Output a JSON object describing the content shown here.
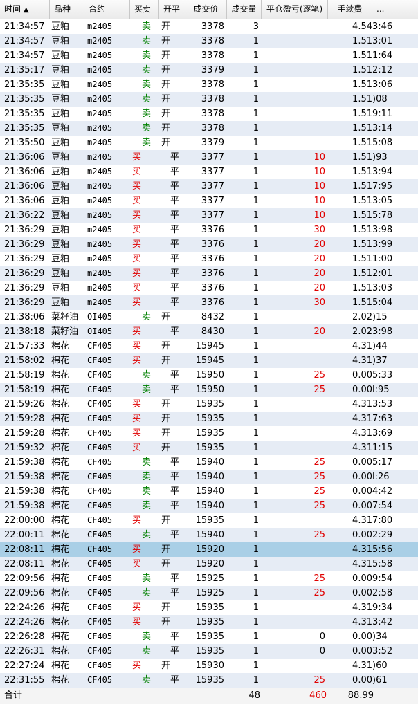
{
  "header": {
    "time": "时间",
    "sort_indicator": "▲",
    "product": "品种",
    "contract": "合约",
    "side": "买卖",
    "open_close": "开平",
    "price": "成交价",
    "volume": "成交量",
    "pnl": "平仓盈亏(逐笔)",
    "fee": "手续费",
    "more": "..."
  },
  "rows": [
    {
      "time": "21:34:57",
      "product": "豆粕",
      "contract": "m2405",
      "side": "卖",
      "oc": "开",
      "price": "3378",
      "vol": "3",
      "pnl": "",
      "fee": "4.54",
      "extra": "3:46"
    },
    {
      "time": "21:34:57",
      "product": "豆粕",
      "contract": "m2405",
      "side": "卖",
      "oc": "开",
      "price": "3378",
      "vol": "1",
      "pnl": "",
      "fee": "1.51",
      "extra": "3:01"
    },
    {
      "time": "21:34:57",
      "product": "豆粕",
      "contract": "m2405",
      "side": "卖",
      "oc": "开",
      "price": "3378",
      "vol": "1",
      "pnl": "",
      "fee": "1.51",
      "extra": "1:64"
    },
    {
      "time": "21:35:17",
      "product": "豆粕",
      "contract": "m2405",
      "side": "卖",
      "oc": "开",
      "price": "3379",
      "vol": "1",
      "pnl": "",
      "fee": "1.51",
      "extra": "2:12"
    },
    {
      "time": "21:35:35",
      "product": "豆粕",
      "contract": "m2405",
      "side": "卖",
      "oc": "开",
      "price": "3378",
      "vol": "1",
      "pnl": "",
      "fee": "1.51",
      "extra": "3:06"
    },
    {
      "time": "21:35:35",
      "product": "豆粕",
      "contract": "m2405",
      "side": "卖",
      "oc": "开",
      "price": "3378",
      "vol": "1",
      "pnl": "",
      "fee": "1.51",
      "extra": ")08"
    },
    {
      "time": "21:35:35",
      "product": "豆粕",
      "contract": "m2405",
      "side": "卖",
      "oc": "开",
      "price": "3378",
      "vol": "1",
      "pnl": "",
      "fee": "1.51",
      "extra": "9:11"
    },
    {
      "time": "21:35:35",
      "product": "豆粕",
      "contract": "m2405",
      "side": "卖",
      "oc": "开",
      "price": "3378",
      "vol": "1",
      "pnl": "",
      "fee": "1.51",
      "extra": "3:14"
    },
    {
      "time": "21:35:50",
      "product": "豆粕",
      "contract": "m2405",
      "side": "卖",
      "oc": "开",
      "price": "3379",
      "vol": "1",
      "pnl": "",
      "fee": "1.51",
      "extra": "5:08"
    },
    {
      "time": "21:36:06",
      "product": "豆粕",
      "contract": "m2405",
      "side": "买",
      "oc": "平",
      "price": "3377",
      "vol": "1",
      "pnl": "10",
      "fee": "1.51",
      "extra": ")93"
    },
    {
      "time": "21:36:06",
      "product": "豆粕",
      "contract": "m2405",
      "side": "买",
      "oc": "平",
      "price": "3377",
      "vol": "1",
      "pnl": "10",
      "fee": "1.51",
      "extra": "3:94"
    },
    {
      "time": "21:36:06",
      "product": "豆粕",
      "contract": "m2405",
      "side": "买",
      "oc": "平",
      "price": "3377",
      "vol": "1",
      "pnl": "10",
      "fee": "1.51",
      "extra": "7:95"
    },
    {
      "time": "21:36:06",
      "product": "豆粕",
      "contract": "m2405",
      "side": "买",
      "oc": "平",
      "price": "3377",
      "vol": "1",
      "pnl": "10",
      "fee": "1.51",
      "extra": "3:05"
    },
    {
      "time": "21:36:22",
      "product": "豆粕",
      "contract": "m2405",
      "side": "买",
      "oc": "平",
      "price": "3377",
      "vol": "1",
      "pnl": "10",
      "fee": "1.51",
      "extra": "5:78"
    },
    {
      "time": "21:36:29",
      "product": "豆粕",
      "contract": "m2405",
      "side": "买",
      "oc": "平",
      "price": "3376",
      "vol": "1",
      "pnl": "30",
      "fee": "1.51",
      "extra": "3:98"
    },
    {
      "time": "21:36:29",
      "product": "豆粕",
      "contract": "m2405",
      "side": "买",
      "oc": "平",
      "price": "3376",
      "vol": "1",
      "pnl": "20",
      "fee": "1.51",
      "extra": "3:99"
    },
    {
      "time": "21:36:29",
      "product": "豆粕",
      "contract": "m2405",
      "side": "买",
      "oc": "平",
      "price": "3376",
      "vol": "1",
      "pnl": "20",
      "fee": "1.51",
      "extra": "1:00"
    },
    {
      "time": "21:36:29",
      "product": "豆粕",
      "contract": "m2405",
      "side": "买",
      "oc": "平",
      "price": "3376",
      "vol": "1",
      "pnl": "20",
      "fee": "1.51",
      "extra": "2:01"
    },
    {
      "time": "21:36:29",
      "product": "豆粕",
      "contract": "m2405",
      "side": "买",
      "oc": "平",
      "price": "3376",
      "vol": "1",
      "pnl": "20",
      "fee": "1.51",
      "extra": "3:03"
    },
    {
      "time": "21:36:29",
      "product": "豆粕",
      "contract": "m2405",
      "side": "买",
      "oc": "平",
      "price": "3376",
      "vol": "1",
      "pnl": "30",
      "fee": "1.51",
      "extra": "5:04"
    },
    {
      "time": "21:38:06",
      "product": "菜籽油",
      "contract": "OI405",
      "side": "卖",
      "oc": "开",
      "price": "8432",
      "vol": "1",
      "pnl": "",
      "fee": "2.02",
      "extra": ")15"
    },
    {
      "time": "21:38:18",
      "product": "菜籽油",
      "contract": "OI405",
      "side": "买",
      "oc": "平",
      "price": "8430",
      "vol": "1",
      "pnl": "20",
      "fee": "2.02",
      "extra": "3:98"
    },
    {
      "time": "21:57:33",
      "product": "棉花",
      "contract": "CF405",
      "side": "买",
      "oc": "开",
      "price": "15945",
      "vol": "1",
      "pnl": "",
      "fee": "4.31",
      "extra": ")44"
    },
    {
      "time": "21:58:02",
      "product": "棉花",
      "contract": "CF405",
      "side": "买",
      "oc": "开",
      "price": "15945",
      "vol": "1",
      "pnl": "",
      "fee": "4.31",
      "extra": ")37"
    },
    {
      "time": "21:58:19",
      "product": "棉花",
      "contract": "CF405",
      "side": "卖",
      "oc": "平",
      "price": "15950",
      "vol": "1",
      "pnl": "25",
      "fee": "0.00",
      "extra": "5:33"
    },
    {
      "time": "21:58:19",
      "product": "棉花",
      "contract": "CF405",
      "side": "卖",
      "oc": "平",
      "price": "15950",
      "vol": "1",
      "pnl": "25",
      "fee": "0.00",
      "extra": "l:95"
    },
    {
      "time": "21:59:26",
      "product": "棉花",
      "contract": "CF405",
      "side": "买",
      "oc": "开",
      "price": "15935",
      "vol": "1",
      "pnl": "",
      "fee": "4.31",
      "extra": "3:53"
    },
    {
      "time": "21:59:28",
      "product": "棉花",
      "contract": "CF405",
      "side": "买",
      "oc": "开",
      "price": "15935",
      "vol": "1",
      "pnl": "",
      "fee": "4.31",
      "extra": "7:63"
    },
    {
      "time": "21:59:28",
      "product": "棉花",
      "contract": "CF405",
      "side": "买",
      "oc": "开",
      "price": "15935",
      "vol": "1",
      "pnl": "",
      "fee": "4.31",
      "extra": "3:69"
    },
    {
      "time": "21:59:32",
      "product": "棉花",
      "contract": "CF405",
      "side": "买",
      "oc": "开",
      "price": "15935",
      "vol": "1",
      "pnl": "",
      "fee": "4.31",
      "extra": "1:15"
    },
    {
      "time": "21:59:38",
      "product": "棉花",
      "contract": "CF405",
      "side": "卖",
      "oc": "平",
      "price": "15940",
      "vol": "1",
      "pnl": "25",
      "fee": "0.00",
      "extra": "5:17"
    },
    {
      "time": "21:59:38",
      "product": "棉花",
      "contract": "CF405",
      "side": "卖",
      "oc": "平",
      "price": "15940",
      "vol": "1",
      "pnl": "25",
      "fee": "0.00",
      "extra": "l:26"
    },
    {
      "time": "21:59:38",
      "product": "棉花",
      "contract": "CF405",
      "side": "卖",
      "oc": "平",
      "price": "15940",
      "vol": "1",
      "pnl": "25",
      "fee": "0.00",
      "extra": "4:42"
    },
    {
      "time": "21:59:38",
      "product": "棉花",
      "contract": "CF405",
      "side": "卖",
      "oc": "平",
      "price": "15940",
      "vol": "1",
      "pnl": "25",
      "fee": "0.00",
      "extra": "7:54"
    },
    {
      "time": "22:00:00",
      "product": "棉花",
      "contract": "CF405",
      "side": "买",
      "oc": "开",
      "price": "15935",
      "vol": "1",
      "pnl": "",
      "fee": "4.31",
      "extra": "7:80"
    },
    {
      "time": "22:00:11",
      "product": "棉花",
      "contract": "CF405",
      "side": "卖",
      "oc": "平",
      "price": "15940",
      "vol": "1",
      "pnl": "25",
      "fee": "0.00",
      "extra": "2:29"
    },
    {
      "time": "22:08:11",
      "product": "棉花",
      "contract": "CF405",
      "side": "买",
      "oc": "开",
      "price": "15920",
      "vol": "1",
      "pnl": "",
      "fee": "4.31",
      "extra": "5:56"
    },
    {
      "time": "22:08:11",
      "product": "棉花",
      "contract": "CF405",
      "side": "买",
      "oc": "开",
      "price": "15920",
      "vol": "1",
      "pnl": "",
      "fee": "4.31",
      "extra": "5:58"
    },
    {
      "time": "22:09:56",
      "product": "棉花",
      "contract": "CF405",
      "side": "卖",
      "oc": "平",
      "price": "15925",
      "vol": "1",
      "pnl": "25",
      "fee": "0.00",
      "extra": "9:54"
    },
    {
      "time": "22:09:56",
      "product": "棉花",
      "contract": "CF405",
      "side": "卖",
      "oc": "平",
      "price": "15925",
      "vol": "1",
      "pnl": "25",
      "fee": "0.00",
      "extra": "2:58"
    },
    {
      "time": "22:24:26",
      "product": "棉花",
      "contract": "CF405",
      "side": "买",
      "oc": "开",
      "price": "15935",
      "vol": "1",
      "pnl": "",
      "fee": "4.31",
      "extra": "9:34"
    },
    {
      "time": "22:24:26",
      "product": "棉花",
      "contract": "CF405",
      "side": "买",
      "oc": "开",
      "price": "15935",
      "vol": "1",
      "pnl": "",
      "fee": "4.31",
      "extra": "3:42"
    },
    {
      "time": "22:26:28",
      "product": "棉花",
      "contract": "CF405",
      "side": "卖",
      "oc": "平",
      "price": "15935",
      "vol": "1",
      "pnl": "0",
      "fee": "0.00",
      "extra": ")34"
    },
    {
      "time": "22:26:31",
      "product": "棉花",
      "contract": "CF405",
      "side": "卖",
      "oc": "平",
      "price": "15935",
      "vol": "1",
      "pnl": "0",
      "fee": "0.00",
      "extra": "3:52"
    },
    {
      "time": "22:27:24",
      "product": "棉花",
      "contract": "CF405",
      "side": "买",
      "oc": "开",
      "price": "15930",
      "vol": "1",
      "pnl": "",
      "fee": "4.31",
      "extra": ")60"
    },
    {
      "time": "22:31:55",
      "product": "棉花",
      "contract": "CF405",
      "side": "卖",
      "oc": "平",
      "price": "15935",
      "vol": "1",
      "pnl": "25",
      "fee": "0.00",
      "extra": ")61"
    }
  ],
  "selected_row_index": 36,
  "footer": {
    "label": "合计",
    "total_volume": "48",
    "total_pnl": "460",
    "total_fee": "88.99"
  },
  "colors": {
    "buy": "#e00000",
    "sell": "#008000",
    "row_alt": "#e6ecf5",
    "row_selected": "#a9cfe6"
  }
}
